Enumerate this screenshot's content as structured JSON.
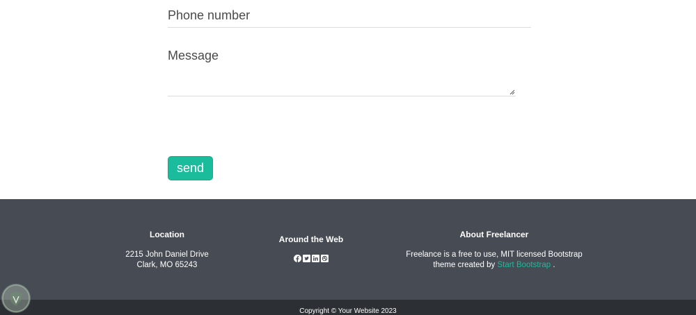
{
  "form": {
    "phone_label": "Phone number",
    "message_label": "Message",
    "send_label": "send"
  },
  "footer": {
    "location": {
      "title": "Location",
      "line1": "2215 John Daniel Drive",
      "line2": "Clark, MO 65243"
    },
    "web": {
      "title": "Around the Web",
      "icons": [
        "facebook-icon",
        "twitter-icon",
        "linkedin-icon",
        "dribbble-icon"
      ]
    },
    "about": {
      "title": "About Freelancer",
      "line1": "Freelance is a free to use, MIT licensed Bootstrap",
      "line2_prefix": "theme created by ",
      "link_text": "Start Bootstrap",
      "line2_suffix": " ."
    }
  },
  "copyright": "Copyright © Your Website 2023",
  "colors": {
    "accent": "#1abc9c",
    "footer_bg": "#474b53",
    "copyright_bg": "#2c2f33"
  }
}
